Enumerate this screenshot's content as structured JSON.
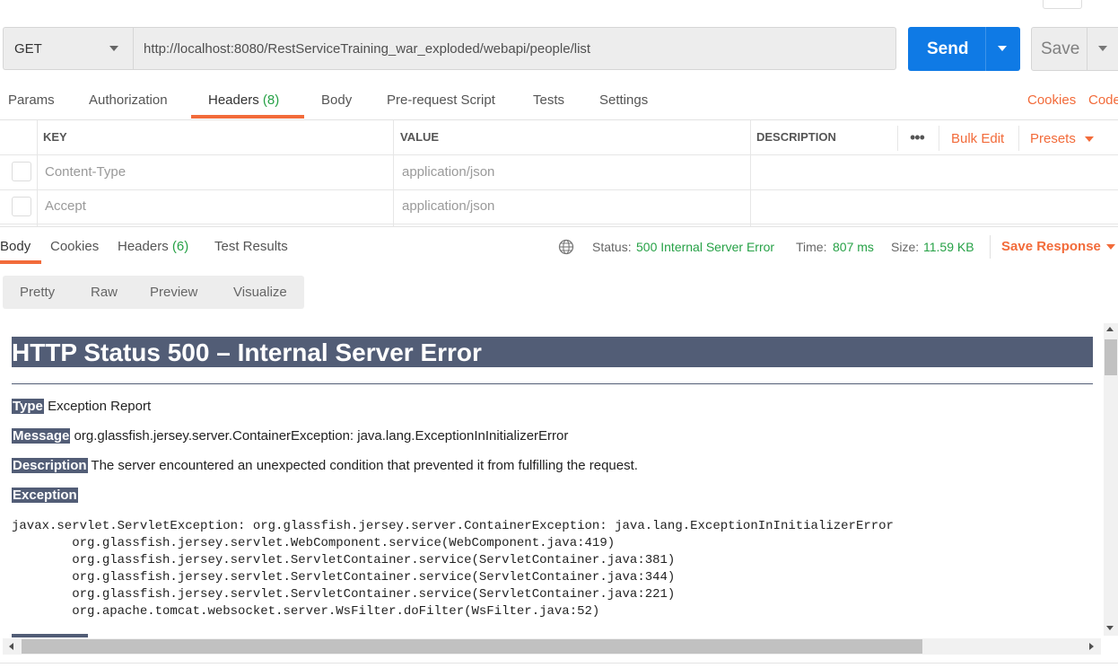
{
  "request": {
    "method": "GET",
    "url": "http://localhost:8080/RestServiceTraining_war_exploded/webapi/people/list",
    "send_label": "Send",
    "save_label": "Save"
  },
  "request_tabs": {
    "params": "Params",
    "authorization": "Authorization",
    "headers": "Headers",
    "headers_count": "(8)",
    "body": "Body",
    "prerequest": "Pre-request Script",
    "tests": "Tests",
    "settings": "Settings",
    "cookies": "Cookies",
    "code": "Code"
  },
  "headers_table": {
    "columns": {
      "key": "KEY",
      "value": "VALUE",
      "description": "DESCRIPTION"
    },
    "more": "•••",
    "bulk_edit": "Bulk Edit",
    "presets": "Presets",
    "rows": [
      {
        "key": "Content-Type",
        "value": "application/json"
      },
      {
        "key": "Accept",
        "value": "application/json"
      }
    ]
  },
  "response_tabs": {
    "body": "Body",
    "cookies": "Cookies",
    "headers": "Headers",
    "headers_count": "(6)",
    "test_results": "Test Results"
  },
  "response_status": {
    "status_label": "Status:",
    "status_value": "500 Internal Server Error",
    "time_label": "Time:",
    "time_value": "807 ms",
    "size_label": "Size:",
    "size_value": "11.59 KB",
    "save_response": "Save Response"
  },
  "view_modes": {
    "pretty": "Pretty",
    "raw": "Raw",
    "preview": "Preview",
    "visualize": "Visualize"
  },
  "preview": {
    "title": "HTTP Status 500 – Internal Server Error",
    "type_label": "Type",
    "type_value": " Exception Report",
    "message_label": "Message",
    "message_value": " org.glassfish.jersey.server.ContainerException: java.lang.ExceptionInInitializerError",
    "description_label": "Description",
    "description_value": " The server encountered an unexpected condition that prevented it from fulfilling the request.",
    "exception_label": "Exception",
    "stacktrace": "javax.servlet.ServletException: org.glassfish.jersey.server.ContainerException: java.lang.ExceptionInInitializerError\n\torg.glassfish.jersey.servlet.WebComponent.service(WebComponent.java:419)\n\torg.glassfish.jersey.servlet.ServletContainer.service(ServletContainer.java:381)\n\torg.glassfish.jersey.servlet.ServletContainer.service(ServletContainer.java:344)\n\torg.glassfish.jersey.servlet.ServletContainer.service(ServletContainer.java:221)\n\torg.apache.tomcat.websocket.server.WsFilter.doFilter(WsFilter.java:52)"
  },
  "colors": {
    "accent": "#f26b3a",
    "send_blue": "#0f7ae5",
    "success_green": "#26a146",
    "tomcat_header": "#525d76"
  }
}
